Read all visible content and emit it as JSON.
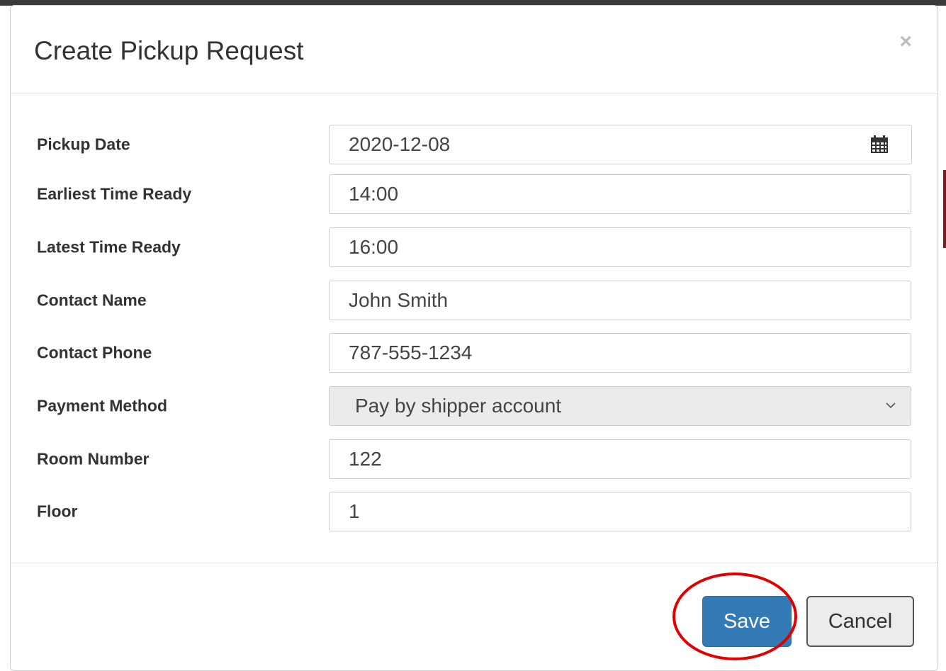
{
  "modal": {
    "title": "Create Pickup Request",
    "close_label": "×"
  },
  "form": {
    "pickup_date": {
      "label": "Pickup Date",
      "value": "2020-12-08"
    },
    "earliest_time": {
      "label": "Earliest Time Ready",
      "value": "14:00"
    },
    "latest_time": {
      "label": "Latest Time Ready",
      "value": "16:00"
    },
    "contact_name": {
      "label": "Contact Name",
      "value": "John Smith"
    },
    "contact_phone": {
      "label": "Contact Phone",
      "value": "787-555-1234"
    },
    "payment_method": {
      "label": "Payment Method",
      "value": "Pay by shipper account"
    },
    "room_number": {
      "label": "Room Number",
      "value": "122"
    },
    "floor": {
      "label": "Floor",
      "value": "1"
    }
  },
  "footer": {
    "save_label": "Save",
    "cancel_label": "Cancel"
  },
  "colors": {
    "primary": "#337ab7",
    "highlight": "#e00000"
  },
  "icons": {
    "date_addon": "calendar-icon",
    "select_caret": "chevron-down-icon",
    "close": "close-icon"
  }
}
